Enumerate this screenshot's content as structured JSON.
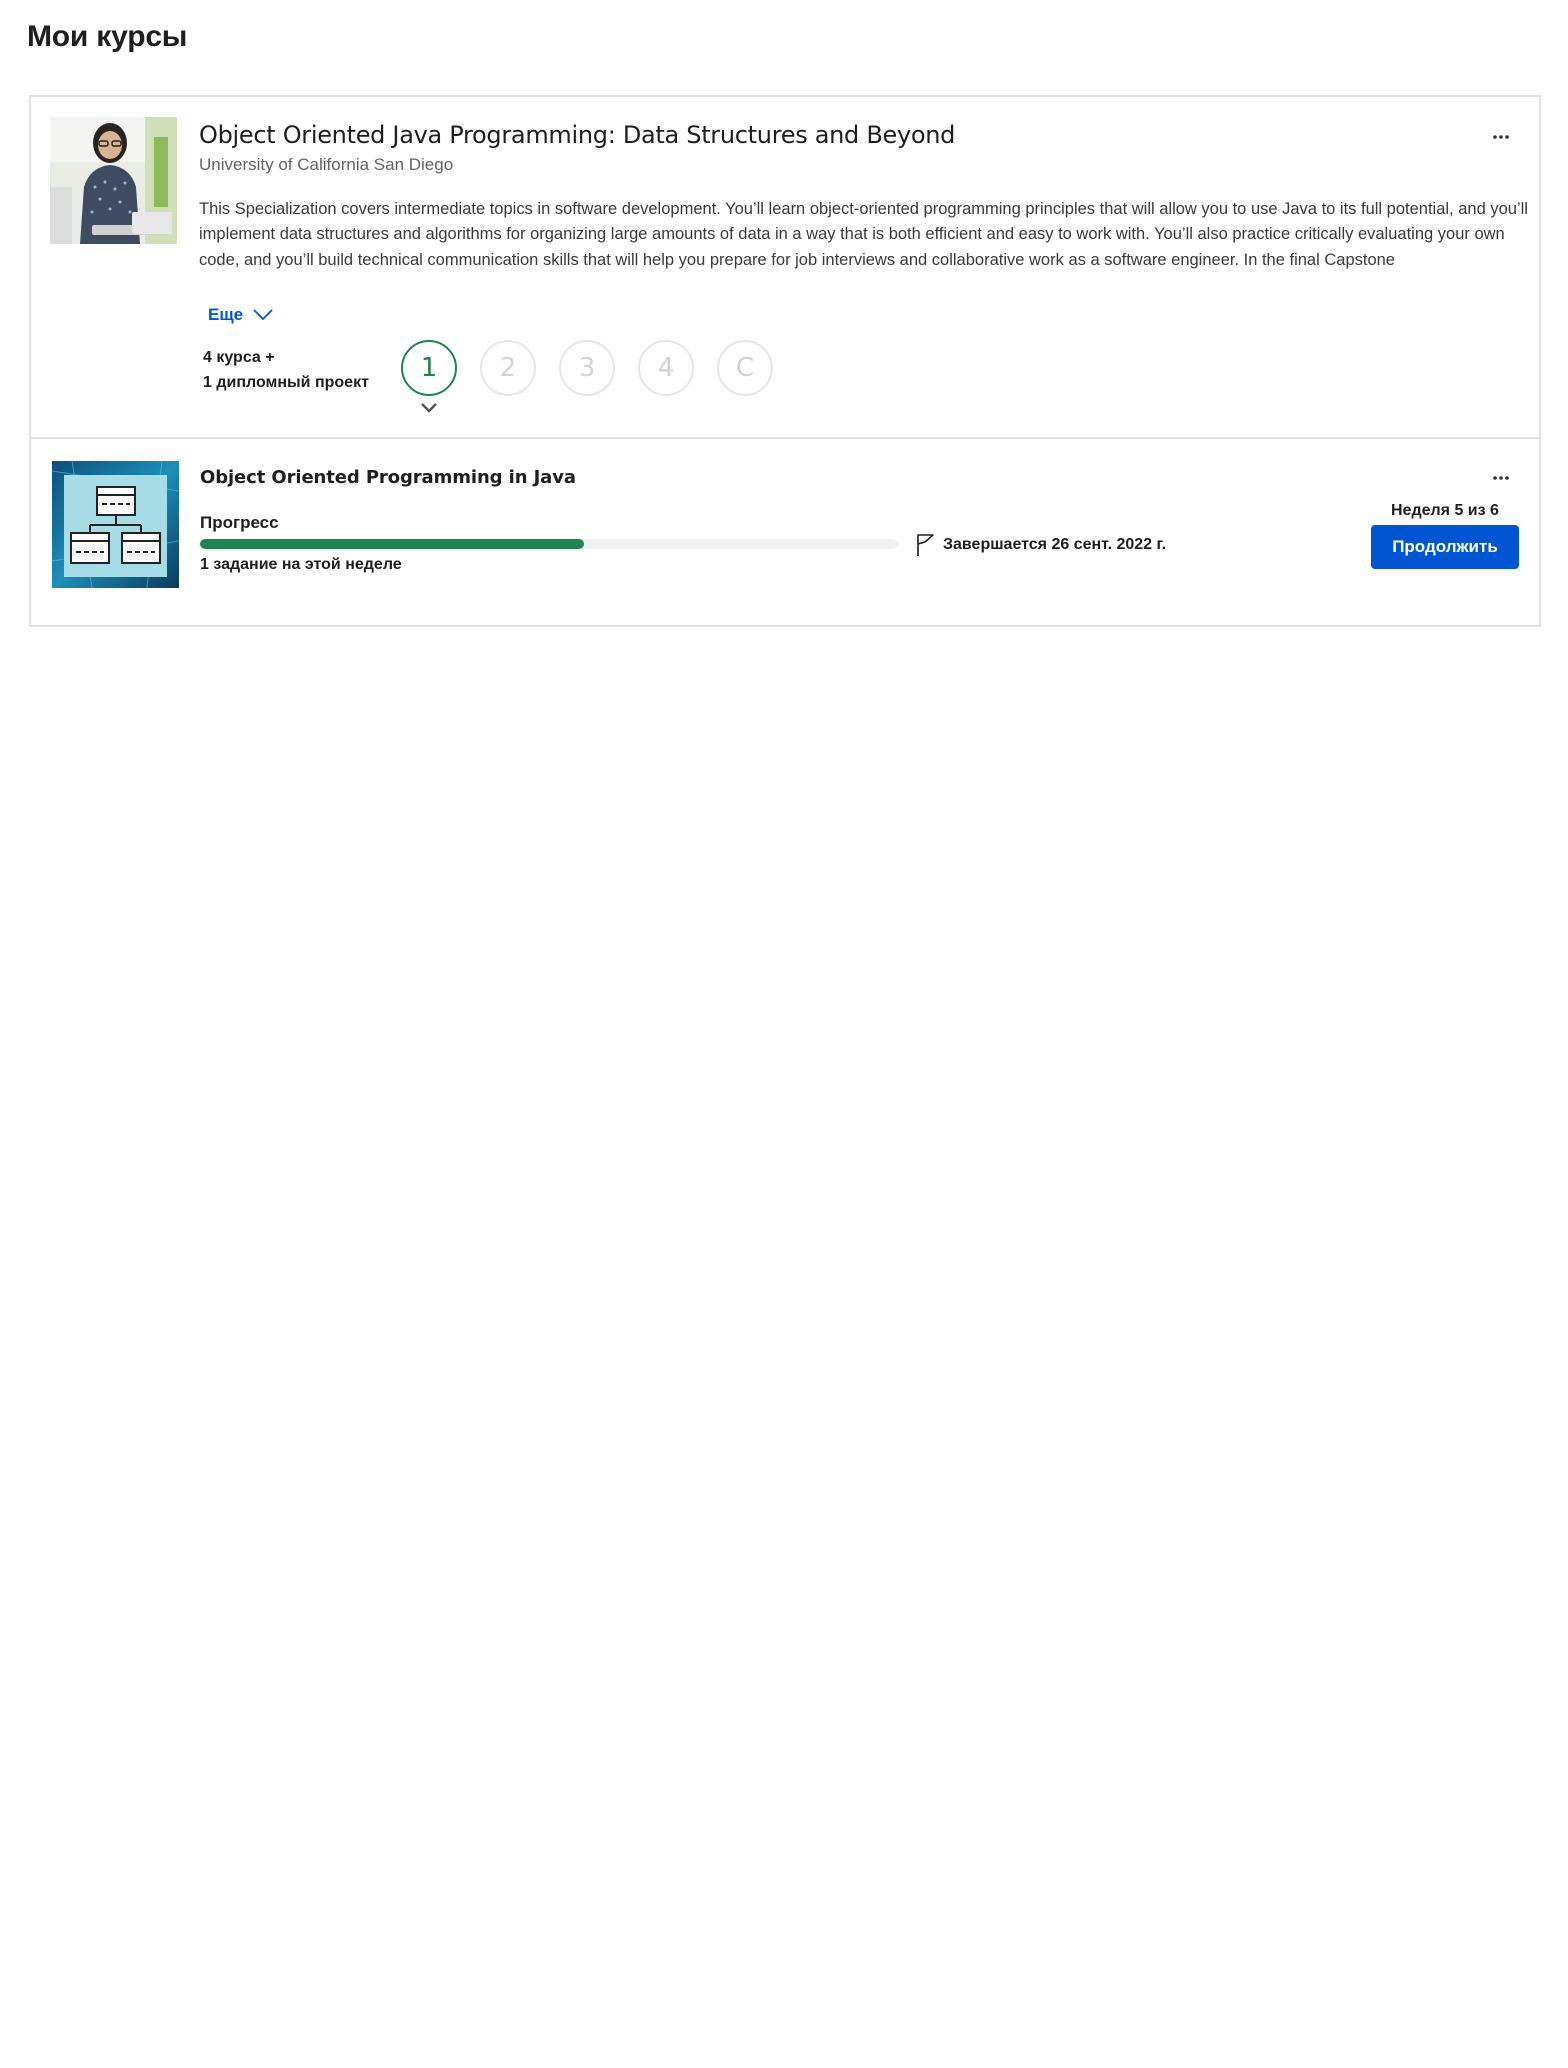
{
  "page": {
    "title": "Мои курсы"
  },
  "specialization": {
    "title": "Object Oriented Java Programming: Data Structures and Beyond",
    "university": "University of California San Diego",
    "description": "This Specialization covers intermediate topics in software development. You’ll learn object-oriented programming principles that will allow you to use Java to its full potential, and you’ll implement data structures and algorithms for organizing large amounts of data in a way that is both efficient and easy to work with. You’ll also practice critically evaluating your own code, and you’ll build technical communication skills that will help you prepare for job interviews and collaborative work as a software engineer. In the final Capstone",
    "more_label": "Еще",
    "courses_line1": "4 курса +",
    "courses_line2": "1 дипломный проект",
    "steps": [
      "1",
      "2",
      "3",
      "4",
      "C"
    ],
    "active_step": "1"
  },
  "course": {
    "title": "Object Oriented Programming in Java",
    "progress_label": "Прогресс",
    "progress_fraction": 0.55,
    "assignments": "1 задание на этой неделе",
    "deadline": "Завершается 26 сент. 2022 г.",
    "week": "Неделя 5 из 6",
    "continue_label": "Продолжить"
  },
  "icons": {
    "menu": "more-horizontal-icon",
    "chevron": "chevron-down-icon",
    "flag": "flag-icon"
  },
  "colors": {
    "accent": "#0056d2",
    "progress": "#1f8354",
    "active_step": "#1f8354"
  }
}
